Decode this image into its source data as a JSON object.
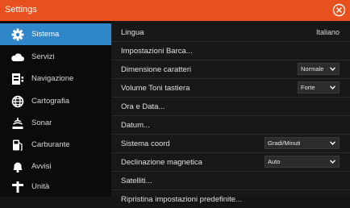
{
  "window": {
    "title": "Settings"
  },
  "colors": {
    "accent": "#e8511e",
    "selected": "#2f86c8"
  },
  "sidebar": {
    "items": [
      {
        "label": "Sistema",
        "icon": "gear-icon",
        "active": true
      },
      {
        "label": "Servizi",
        "icon": "cloud-icon"
      },
      {
        "label": "Navigazione",
        "icon": "navigation-icon"
      },
      {
        "label": "Cartografia",
        "icon": "globe-icon"
      },
      {
        "label": "Sonar",
        "icon": "sonar-icon"
      },
      {
        "label": "Carburante",
        "icon": "fuel-pump-icon"
      },
      {
        "label": "Avvisi",
        "icon": "alarm-bell-icon"
      },
      {
        "label": "Unità",
        "icon": "units-icon"
      }
    ]
  },
  "settings": {
    "lingua": {
      "label": "Lingua",
      "value": "Italiano"
    },
    "impostazioni_barca": {
      "label": "Impostazioni Barca..."
    },
    "dimensione_caratteri": {
      "label": "Dimensione caratteri",
      "value": "Normale"
    },
    "volume_toni": {
      "label": "Volume Toni tastiera",
      "value": "Forte"
    },
    "ora_data": {
      "label": "Ora e Data..."
    },
    "datum": {
      "label": "Datum..."
    },
    "sistema_coord": {
      "label": "Sistema coord",
      "value": "Gradi/Minuti"
    },
    "declinazione": {
      "label": "Declinazione magnetica",
      "value": "Auto"
    },
    "satelliti": {
      "label": "Satelliti..."
    },
    "ripristina": {
      "label": "Ripristina impostazioni predefinite..."
    }
  }
}
